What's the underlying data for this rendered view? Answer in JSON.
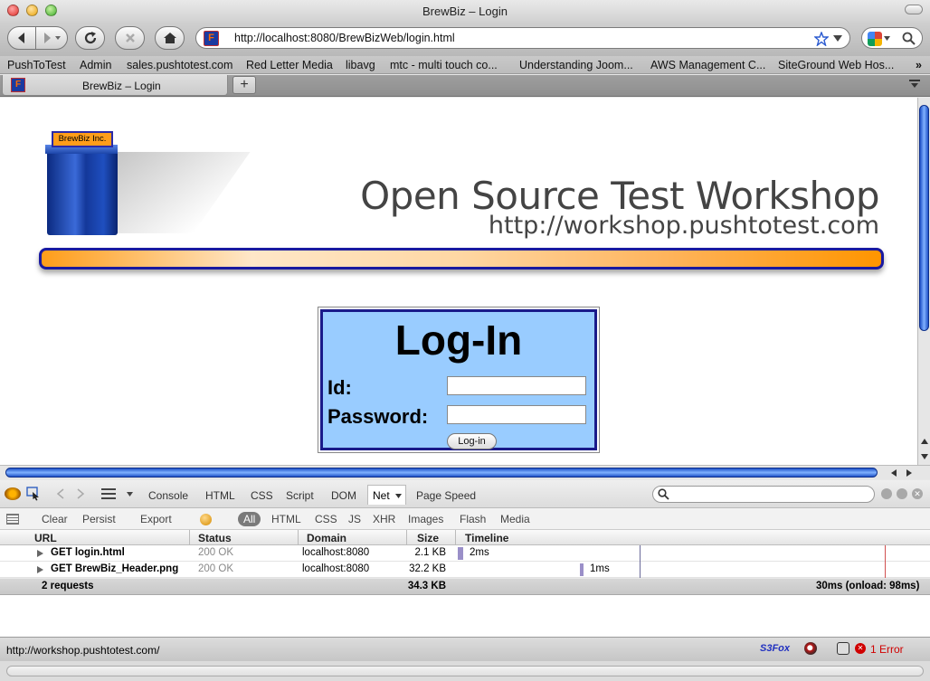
{
  "window": {
    "title": "BrewBiz – Login"
  },
  "navbar": {
    "url": "http://localhost:8080/BrewBizWeb/login.html"
  },
  "bookmarks": [
    "PushToTest",
    "Admin",
    "sales.pushtotest.com",
    "Red Letter Media",
    "libavg",
    "mtc - multi touch co...",
    "Understanding Joom...",
    "AWS Management C...",
    "SiteGround Web Hos..."
  ],
  "tab": {
    "label": "BrewBiz – Login",
    "new_tab": "+"
  },
  "page": {
    "logo_label": "BrewBiz Inc.",
    "banner_title": "Open Source Test Workshop",
    "banner_url": "http://workshop.pushtotest.com",
    "login": {
      "title": "Log-In",
      "id_label": "Id:",
      "password_label": "Password:",
      "button": "Log-in",
      "id_value": "",
      "password_value": ""
    }
  },
  "firebug": {
    "tabs": [
      "Console",
      "HTML",
      "CSS",
      "Script",
      "DOM",
      "Net",
      "Page Speed"
    ],
    "active_tab": "Net",
    "actions": [
      "Clear",
      "Persist",
      "Export"
    ],
    "filters": [
      "All",
      "HTML",
      "CSS",
      "JS",
      "XHR",
      "Images",
      "Flash",
      "Media"
    ],
    "active_filter": "All",
    "columns": [
      "URL",
      "Status",
      "Domain",
      "Size",
      "Timeline"
    ],
    "requests": [
      {
        "url": "GET login.html",
        "status": "200 OK",
        "domain": "localhost:8080",
        "size": "2.1 KB",
        "time": "2ms"
      },
      {
        "url": "GET BrewBiz_Header.png",
        "status": "200 OK",
        "domain": "localhost:8080",
        "size": "32.2 KB",
        "time": "1ms"
      }
    ],
    "summary": {
      "count": "2 requests",
      "size": "34.3 KB",
      "timing": "30ms (onload: 98ms)"
    }
  },
  "statusbar": {
    "url": "http://workshop.pushtotest.com/",
    "error": "1 Error",
    "s3fox": "S3Fox"
  },
  "colors": {
    "accent_blue": "#1f52c8",
    "login_bg": "#99ccff",
    "bar_orange": "#ff9500",
    "error_red": "#d00000"
  }
}
